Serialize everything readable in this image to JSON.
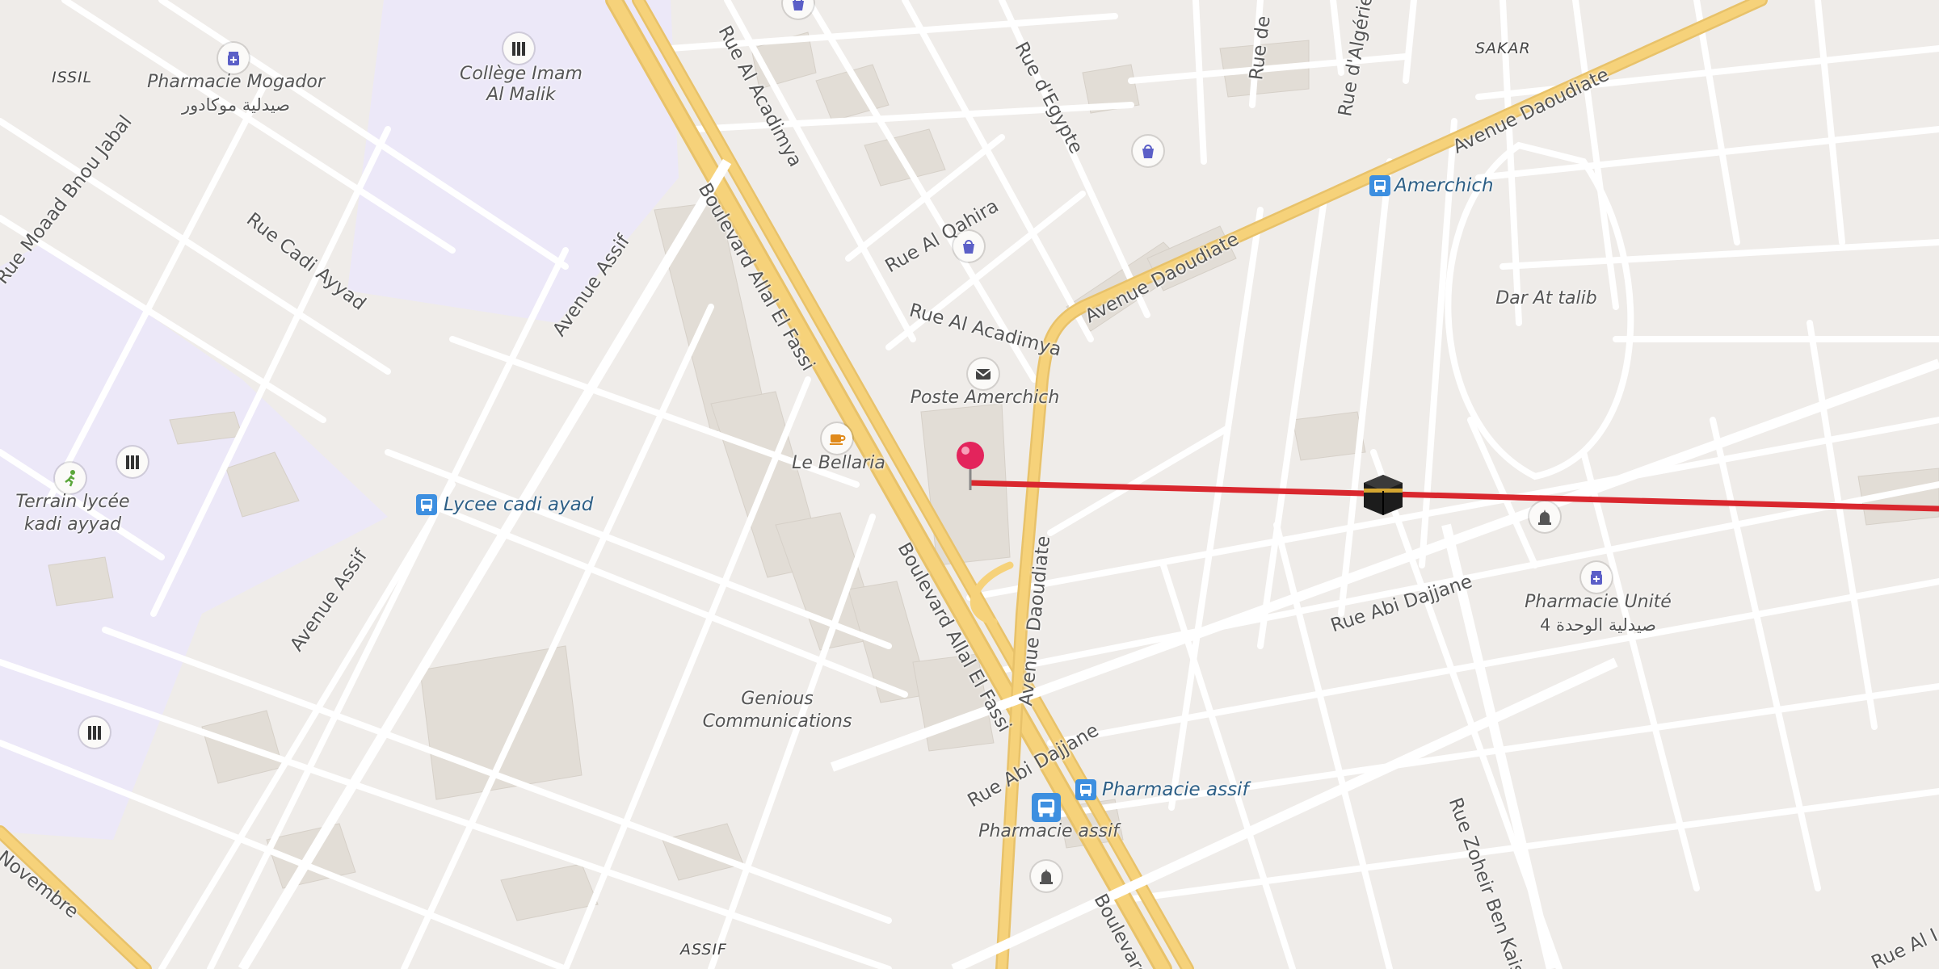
{
  "map": {
    "districts": [
      "ISSIL",
      "SAKAR",
      "ASSIF"
    ],
    "streets": [
      "Boulevard Allal El Fassi",
      "Boulevard Allal El Fassi",
      "Boulevard",
      "Avenue Daoudiate",
      "Avenue Daoudiate",
      "Avenue Daoudiate",
      "Avenue Assif",
      "Avenue Assif",
      "Rue Al Acadimya",
      "Rue Al Acadimya",
      "Rue Al Qahira",
      "Rue d'Egypte",
      "Rue Cadi Ayyad",
      "Rue Moaad Bnou Jabal",
      "Rue Abi Dajjane",
      "Rue Abi Dajjane",
      "Rue Zoheir Ben Kaiss",
      "Rue de",
      "Rue d'Algérie",
      "Novembre",
      "Rue Al I"
    ],
    "places": {
      "college": [
        "Collège Imam",
        "Al Malik"
      ],
      "pharmacie_mogador": [
        "Pharmacie Mogador",
        "صيدلية موكادور"
      ],
      "terrain": [
        "Terrain lycée",
        "kadi ayyad"
      ],
      "poste": "Poste Amerchich",
      "bellaria": "Le Bellaria",
      "dar_at_talib": "Dar At talib",
      "pharmacie_unite": [
        "Pharmacie Unité",
        "صيدلية الوحدة 4"
      ],
      "genious": [
        "Genious",
        "Communications"
      ],
      "pharmacie_assif_stop": "Pharmacie assif"
    },
    "transit": {
      "amerchich": "Amerchich",
      "lycee": "Lycee cadi ayad",
      "pharmacie_assif": "Pharmacie assif"
    },
    "icons": {
      "pharmacy": "pharmacy-icon",
      "school": "school-icon",
      "sports": "sports-icon",
      "post": "post-office-icon",
      "cafe": "cafe-icon",
      "shop": "shopping-bag-icon",
      "bus": "bus-stop-icon",
      "mosque": "mosque-icon",
      "kaaba": "kaaba-icon",
      "pin": "location-pin-icon"
    },
    "colors": {
      "background": "#efece9",
      "road": "#ffffff",
      "major_road": "#f6d27a",
      "school_area": "#ece8f8",
      "building": "#e2ddd6",
      "qibla_line": "#d9272e",
      "bus": "#3d8fe0",
      "pin": "#e3245c"
    }
  }
}
